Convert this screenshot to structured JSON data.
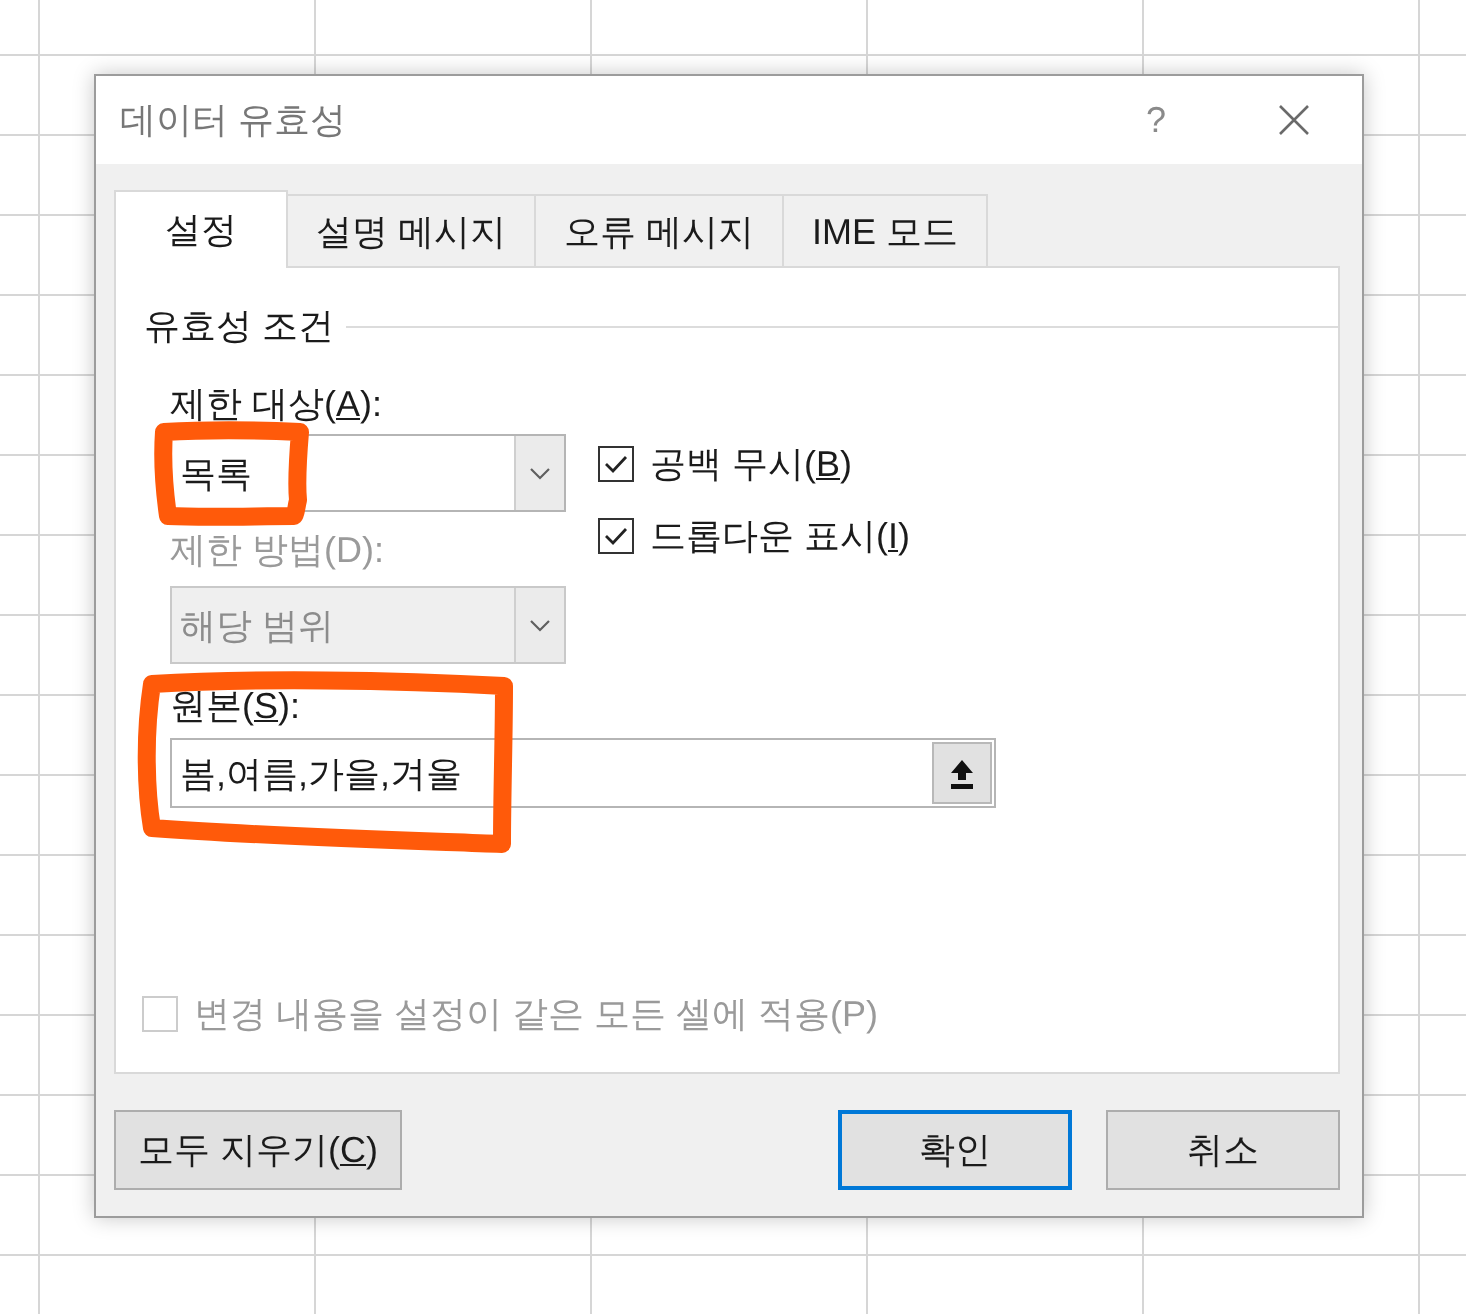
{
  "window": {
    "title": "데이터 유효성",
    "help": "?"
  },
  "tabs": [
    {
      "label": "설정",
      "selected": true
    },
    {
      "label": "설명 메시지",
      "selected": false
    },
    {
      "label": "오류 메시지",
      "selected": false
    },
    {
      "label": "IME 모드",
      "selected": false
    }
  ],
  "settings": {
    "section_title": "유효성 조건",
    "allow": {
      "label": "제한 대상(",
      "access_key": "A",
      "label_end": "):",
      "value": "목록",
      "disabled": false,
      "highlighted": true
    },
    "data": {
      "label": "제한 방법(D):",
      "value": "해당 범위",
      "disabled": true
    },
    "options": [
      {
        "label": "공백 무시(",
        "access_key": "B",
        "label_end": ")",
        "checked": true
      },
      {
        "label": "드롭다운 표시(",
        "access_key": "I",
        "label_end": ")",
        "checked": true
      }
    ],
    "source": {
      "label": "원본(",
      "access_key": "S",
      "label_end": "):",
      "value": "봄,여름,가을,겨울",
      "highlighted": true
    },
    "apply_all": {
      "label": "변경 내용을 설정이 같은 모든 셀에 적용(P)",
      "checked": false,
      "disabled": true
    }
  },
  "footer": {
    "left_buttons": [
      {
        "label": "모두 지우기(",
        "access_key": "C",
        "label_end": ")",
        "default": false
      }
    ],
    "right_buttons": [
      {
        "label": "확인",
        "default": true
      },
      {
        "label": "취소",
        "default": false
      }
    ]
  }
}
